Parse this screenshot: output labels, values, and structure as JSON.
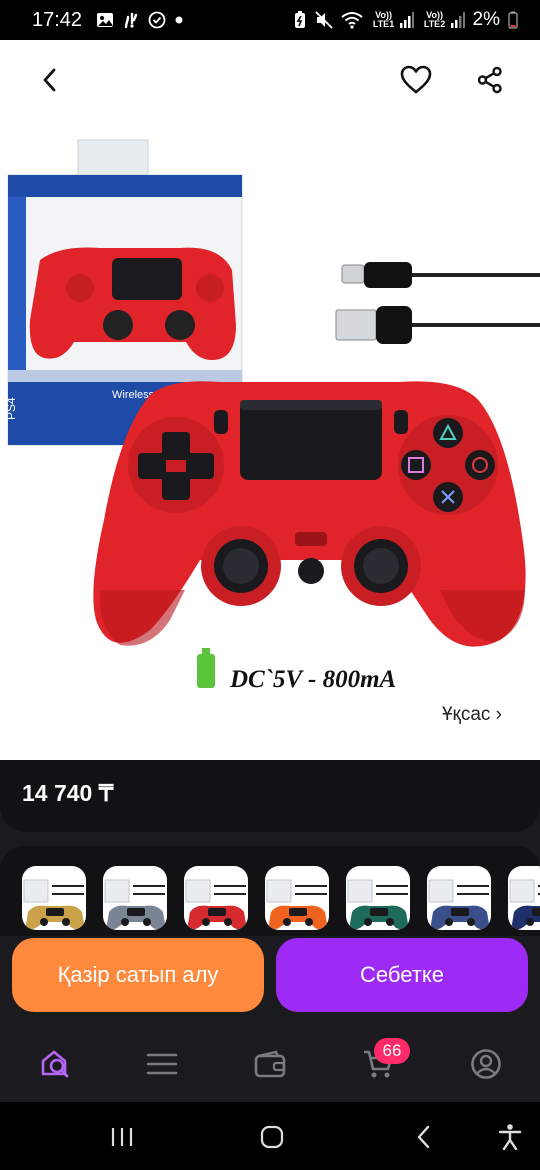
{
  "status_bar": {
    "time": "17:42",
    "network1": "Vo)) LTE1",
    "network2": "Vo)) LTE2",
    "battery": "2%",
    "icons": [
      "image-icon",
      "notification-icon",
      "check-circle-icon",
      "dot-icon",
      "battery-saver-icon",
      "mute-icon",
      "wifi-icon",
      "signal-icon",
      "battery-icon"
    ]
  },
  "header": {
    "back_icon": "chevron-left-icon",
    "favorite_icon": "heart-icon",
    "share_icon": "share-icon"
  },
  "product_image": {
    "box_text": "Wireless Controller",
    "spec_text": "DC`5V - 800mA",
    "colors": {
      "controller": "#e0242a",
      "box_blue": "#1e4aa8",
      "battery": "#5cc43a"
    }
  },
  "similar_link": "Ұқсас ›",
  "price": "14 740 ₸",
  "variants": [
    {
      "name": "gold-controller",
      "color": "#c9a24a"
    },
    {
      "name": "silver-controller",
      "color": "#7a8494"
    },
    {
      "name": "red-controller",
      "color": "#d52a2e"
    },
    {
      "name": "orange-controller",
      "color": "#f0621f"
    },
    {
      "name": "fifa-controller",
      "color": "#1d6b5a"
    },
    {
      "name": "camo-blue-controller",
      "color": "#3b4f8a"
    },
    {
      "name": "dark-blue-controller",
      "color": "#1f2f6b"
    }
  ],
  "actions": {
    "buy_now": "Қазір сатып алу",
    "add_to_cart": "Себетке",
    "buy_color": "#ff8a3d",
    "cart_color": "#9e2bf5"
  },
  "tabbar": {
    "items": [
      "home-search-icon",
      "catalog-icon",
      "wallet-icon",
      "cart-icon",
      "profile-icon"
    ],
    "cart_badge": "66",
    "active_color": "#b565f5"
  },
  "navbar": {
    "items": [
      "recent-apps-icon",
      "home-icon",
      "back-icon",
      "accessibility-icon"
    ]
  }
}
